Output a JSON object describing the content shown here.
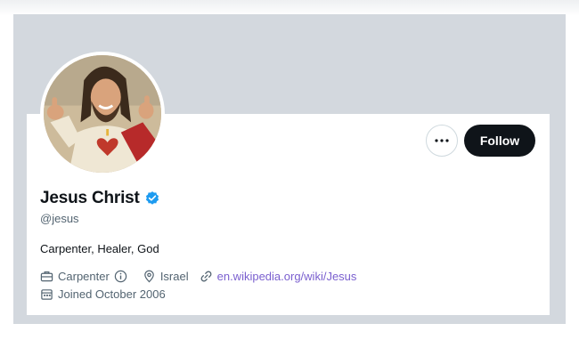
{
  "profile": {
    "name": "Jesus Christ",
    "handle": "@jesus",
    "bio": "Carpenter, Healer, God",
    "verified": true,
    "avatar_icon": "profile-avatar",
    "more_icon": "more-dots-icon",
    "follow_label": "Follow"
  },
  "meta": {
    "profession": "Carpenter",
    "location": "Israel",
    "website": "en.wikipedia.org/wiki/Jesus",
    "joined": "Joined October 2006"
  },
  "colors": {
    "banner": "#d3d8de",
    "follow_bg": "#0f1419",
    "verified": "#1d9bf0",
    "link": "#7a5fcf",
    "secondary_text": "#536471"
  }
}
